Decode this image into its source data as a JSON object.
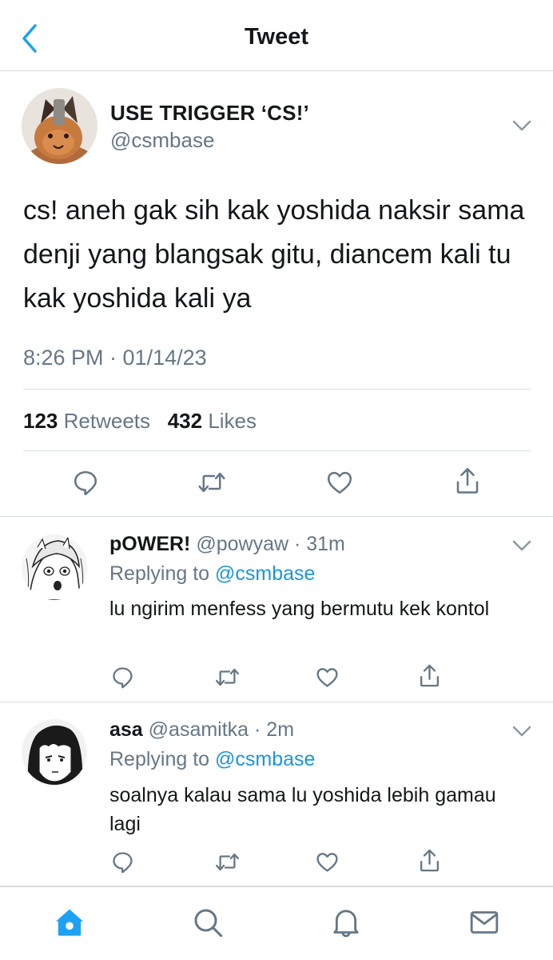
{
  "header": {
    "title": "Tweet",
    "back_icon": "chevron-left-icon"
  },
  "main_tweet": {
    "display_name": "USE TRIGGER ‘CS!’",
    "handle": "@csmbase",
    "text": "cs! aneh gak sih kak yoshida naksir sama denji yang blangsak gitu, diancem kali tu kak yoshida kali ya",
    "timestamp": "8:26 PM · 01/14/23",
    "retweets_count": "123",
    "retweets_label": "Retweets",
    "likes_count": "432",
    "likes_label": "Likes",
    "actions": [
      "reply-icon",
      "retweet-icon",
      "like-icon",
      "share-icon"
    ]
  },
  "replies": [
    {
      "display_name": "pOWER!",
      "meta": "@powyaw · 31m",
      "replying_prefix": "Replying to",
      "replying_to": "@csmbase",
      "text": "lu ngirim menfess yang bermutu kek kontol"
    },
    {
      "display_name": "asa",
      "meta": "@asamitka · 2m",
      "replying_prefix": "Replying to",
      "replying_to": "@csmbase",
      "text": "soalnya kalau sama lu yoshida lebih gamau lagi"
    }
  ],
  "tabbar": {
    "items": [
      "home-icon",
      "search-icon",
      "notifications-icon",
      "messages-icon"
    ],
    "active": "home-icon"
  },
  "colors": {
    "accent": "#1da1f2",
    "mention": "#1b95e0",
    "text": "#14171a",
    "secondary": "#657786",
    "divider": "#d9dde1",
    "icon": "#657786"
  }
}
